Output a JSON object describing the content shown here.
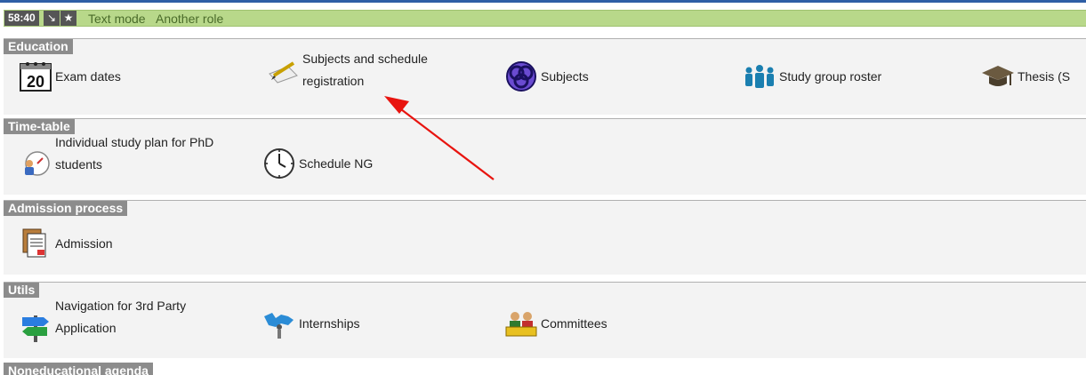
{
  "topbar": {
    "timer": "58:40",
    "btn_collapse": "↘",
    "btn_star": "★",
    "text_mode": "Text mode",
    "another_role": "Another role"
  },
  "sections": {
    "education": {
      "title": "Education",
      "items": [
        {
          "label": "Exam dates",
          "icon": "calendar-icon"
        },
        {
          "label_line1": "Subjects and schedule",
          "label_line2": "registration",
          "icon": "pencil-paper-icon"
        },
        {
          "label": "Subjects",
          "icon": "knot-icon"
        },
        {
          "label": "Study group roster",
          "icon": "people-icon"
        },
        {
          "label": "Thesis (S",
          "icon": "graduation-cap-icon"
        }
      ]
    },
    "timetable": {
      "title": "Time-table",
      "items": [
        {
          "label_line1": "Individual study plan for PhD",
          "label_line2": "students",
          "icon": "study-plan-icon"
        },
        {
          "label": "Schedule NG",
          "icon": "clock-icon"
        }
      ]
    },
    "admission": {
      "title": "Admission process",
      "items": [
        {
          "label": "Admission",
          "icon": "documents-icon"
        }
      ]
    },
    "utils": {
      "title": "Utils",
      "items": [
        {
          "label_line1": "Navigation for 3rd Party",
          "label_line2": "Application",
          "icon": "signpost-icon"
        },
        {
          "label": "Internships",
          "icon": "world-map-person-icon"
        },
        {
          "label": "Committees",
          "icon": "committee-icon"
        }
      ]
    },
    "noneducational": {
      "title": "Noneducational agenda"
    }
  },
  "annotation": {
    "arrow_color": "#e8140f"
  }
}
